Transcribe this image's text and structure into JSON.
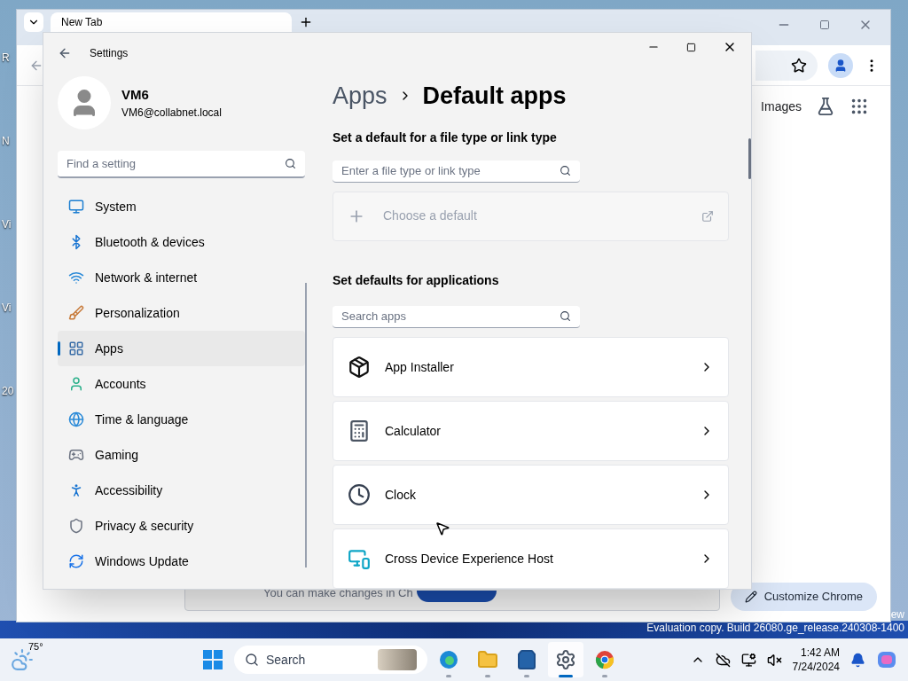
{
  "desktop": {
    "icon_labels": [
      "R",
      "N",
      "Vi",
      "Vi",
      "20"
    ],
    "watermark": [
      "ew",
      "Evaluation copy. Build 26080.ge_release.240308-1400"
    ]
  },
  "browser": {
    "tabs": [
      {
        "label": "New Tab",
        "selected": true
      }
    ],
    "page_links": [
      "Images"
    ],
    "banner_text": "You can make changes in Ch",
    "customize_button": "Customize Chrome"
  },
  "settings": {
    "title": "Settings",
    "user": {
      "name": "VM6",
      "email": "VM6@collabnet.local"
    },
    "search": {
      "placeholder": "Find a setting"
    },
    "nav": [
      {
        "kind": "system",
        "label": "System",
        "selected": false
      },
      {
        "kind": "bluetooth",
        "label": "Bluetooth & devices",
        "selected": false
      },
      {
        "kind": "network",
        "label": "Network & internet",
        "selected": false
      },
      {
        "kind": "personalization",
        "label": "Personalization",
        "selected": false
      },
      {
        "kind": "apps",
        "label": "Apps",
        "selected": true
      },
      {
        "kind": "accounts",
        "label": "Accounts",
        "selected": false
      },
      {
        "kind": "time",
        "label": "Time & language",
        "selected": false
      },
      {
        "kind": "gaming",
        "label": "Gaming",
        "selected": false
      },
      {
        "kind": "accessibility",
        "label": "Accessibility",
        "selected": false
      },
      {
        "kind": "privacy",
        "label": "Privacy & security",
        "selected": false
      },
      {
        "kind": "update",
        "label": "Windows Update",
        "selected": false
      }
    ],
    "breadcrumb": {
      "parent": "Apps",
      "current": "Default apps"
    },
    "file_type_section": {
      "heading": "Set a default for a file type or link type",
      "search": {
        "placeholder": "Enter a file type or link type"
      },
      "choose_default": {
        "label": "Choose a default",
        "disabled": true
      }
    },
    "apps_section": {
      "heading": "Set defaults for applications",
      "search": {
        "placeholder": "Search apps"
      },
      "apps": [
        {
          "kind": "installer",
          "name": "App Installer"
        },
        {
          "kind": "calculator",
          "name": "Calculator"
        },
        {
          "kind": "clock",
          "name": "Clock"
        },
        {
          "kind": "device",
          "name": "Cross Device Experience Host"
        }
      ]
    }
  },
  "taskbar": {
    "weather": "75°",
    "search_placeholder": "Search",
    "pinned": [
      {
        "kind": "edge",
        "active": false
      },
      {
        "kind": "explorer",
        "active": false
      },
      {
        "kind": "store",
        "active": false
      },
      {
        "kind": "settings",
        "active": true
      },
      {
        "kind": "chrome",
        "active": false
      }
    ],
    "time": "1:42 AM",
    "date": "7/24/2024"
  }
}
